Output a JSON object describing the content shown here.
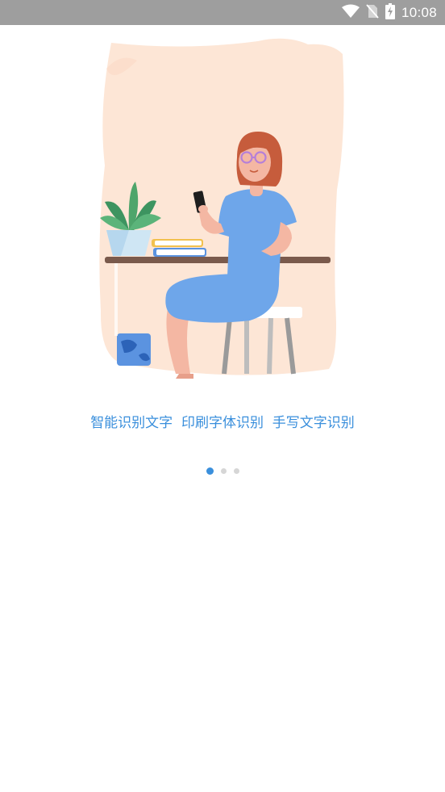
{
  "status_bar": {
    "time": "10:08",
    "icons": [
      "wifi-icon",
      "no-sim-icon",
      "battery-charging-icon"
    ]
  },
  "onboarding": {
    "caption": "智能识别文字  印刷字体识别  手写文字识别",
    "pager": {
      "page_count": 3,
      "current_page": 1
    }
  },
  "colors": {
    "accent": "#3a8fdc",
    "status_bar_bg": "#9e9e9e",
    "background_blob": "#fde6d6",
    "dress": "#6ea6ea",
    "hair": "#c65c3c",
    "desk": "#7a5a4c",
    "plant": "#4ea56b"
  }
}
